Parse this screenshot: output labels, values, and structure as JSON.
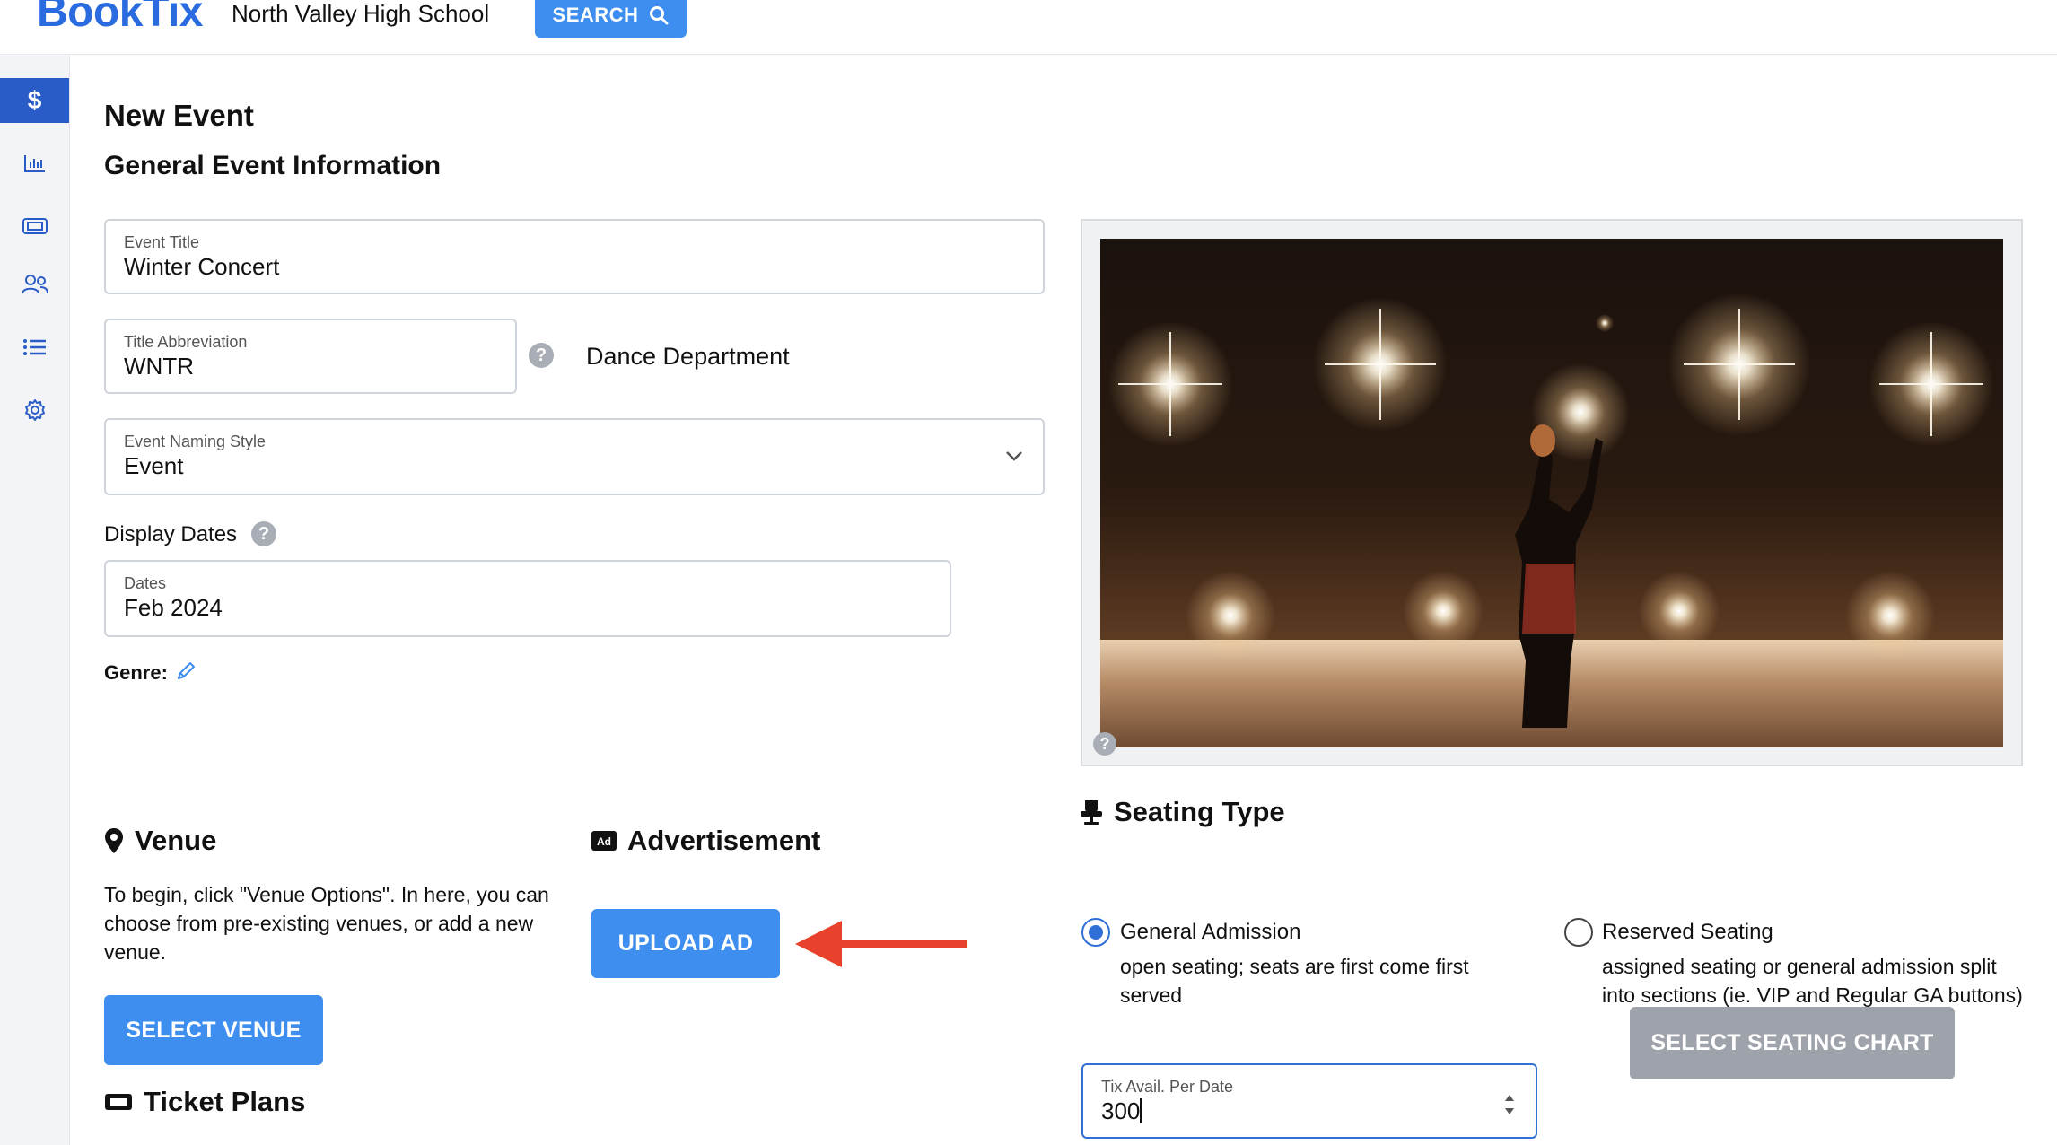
{
  "header": {
    "logo": "BookTix",
    "school": "North Valley High School",
    "search_label": "SEARCH"
  },
  "sidebar": {
    "items": [
      {
        "icon": "dollar-icon",
        "active": true
      },
      {
        "icon": "bar-chart-icon"
      },
      {
        "icon": "ticket-icon"
      },
      {
        "icon": "users-icon"
      },
      {
        "icon": "list-icon"
      },
      {
        "icon": "gear-icon"
      }
    ]
  },
  "page": {
    "title": "New Event",
    "section": "General Event Information"
  },
  "form": {
    "event_title": {
      "label": "Event Title",
      "value": "Winter Concert"
    },
    "abbreviation": {
      "label": "Title Abbreviation",
      "value": "WNTR"
    },
    "department": "Dance Department",
    "naming_style": {
      "label": "Event Naming Style",
      "value": "Event"
    },
    "display_dates_label": "Display Dates",
    "dates": {
      "label": "Dates",
      "value": "Feb 2024"
    },
    "genre_label": "Genre:"
  },
  "venue": {
    "title": "Venue",
    "description": "To begin, click \"Venue Options\". In here, you can choose from pre-existing venues, or add a new venue.",
    "button": "SELECT VENUE"
  },
  "advertisement": {
    "title": "Advertisement",
    "button": "UPLOAD AD"
  },
  "ticket_plans": {
    "title": "Ticket Plans"
  },
  "seating": {
    "title": "Seating Type",
    "options": [
      {
        "label": "General Admission",
        "description": "open seating; seats are first come first served",
        "selected": true
      },
      {
        "label": "Reserved Seating",
        "description": "assigned seating or general admission split into sections (ie. VIP and Regular GA buttons)",
        "selected": false
      }
    ],
    "tix_field": {
      "label": "Tix Avail. Per Date",
      "value": "300"
    },
    "chart_button": "SELECT SEATING CHART"
  },
  "colors": {
    "brand": "#2a6be0",
    "button": "#3e8ef0",
    "sidebar_active": "#2a5cc8",
    "arrow": "#e8412c"
  }
}
